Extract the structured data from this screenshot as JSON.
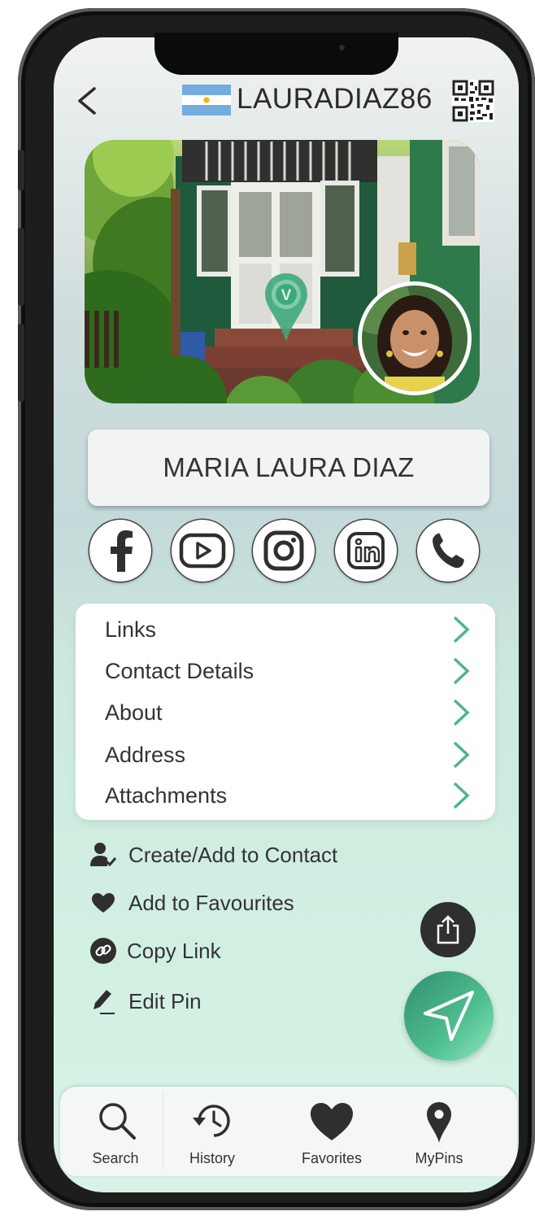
{
  "header": {
    "username": "LAURADIAZ86",
    "flag": "argentina-flag-icon",
    "back_icon": "back-chevron-icon",
    "qr_icon": "qr-code-icon"
  },
  "profile": {
    "cover_photo": "house-cover-photo",
    "pin_icon": "location-pin-v-icon",
    "avatar": "profile-avatar-photo",
    "name": "MARIA LAURA DIAZ"
  },
  "social": [
    {
      "name": "facebook-icon"
    },
    {
      "name": "youtube-icon"
    },
    {
      "name": "instagram-icon"
    },
    {
      "name": "linkedin-icon"
    },
    {
      "name": "phone-icon"
    }
  ],
  "menu": {
    "items": [
      {
        "label": "Links"
      },
      {
        "label": "Contact Details"
      },
      {
        "label": "About"
      },
      {
        "label": "Address"
      },
      {
        "label": "Attachments"
      }
    ],
    "accent": "#4fb58a"
  },
  "actions": [
    {
      "label": "Create/Add to Contact",
      "icon": "add-contact-icon"
    },
    {
      "label": "Add to Favourites",
      "icon": "heart-icon"
    },
    {
      "label": "Copy Link",
      "icon": "link-icon"
    },
    {
      "label": "Edit Pin",
      "icon": "pencil-icon"
    }
  ],
  "tabbar": {
    "tabs": [
      {
        "label": "Search",
        "icon": "search-icon"
      },
      {
        "label": "History",
        "icon": "history-icon"
      },
      {
        "label": "Favorites",
        "icon": "heart-icon"
      },
      {
        "label": "MyPins",
        "icon": "map-pin-icon"
      }
    ]
  },
  "colors": {
    "accent_green": "#4fb58a",
    "dark": "#2f2f2f"
  }
}
